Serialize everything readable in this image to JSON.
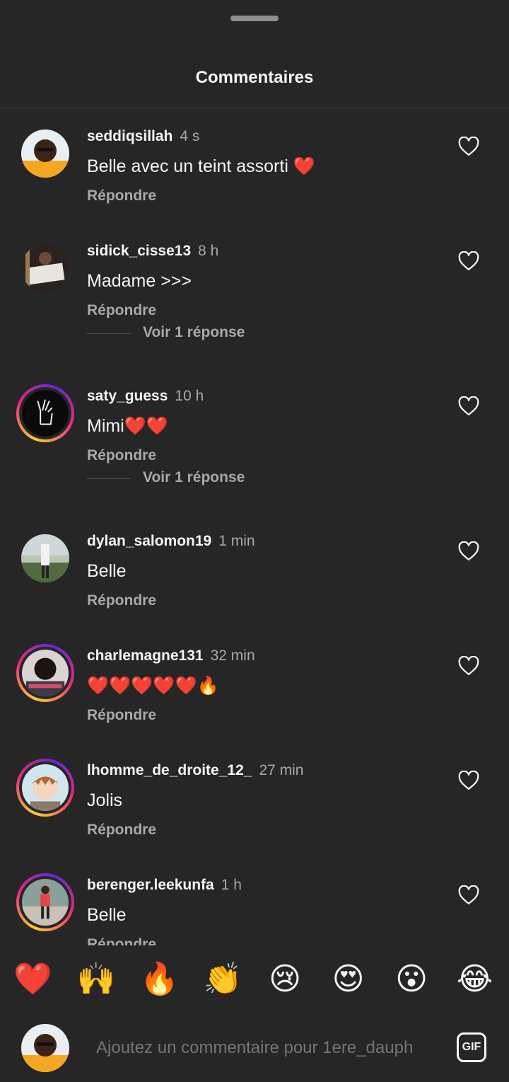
{
  "header": {
    "title": "Commentaires"
  },
  "comments": [
    {
      "username": "seddiqsillah",
      "time": "4 s",
      "text": "Belle avec un teint assorti ❤️",
      "reply_label": "Répondre",
      "ring": false,
      "avatar": "person-yellow-shirt"
    },
    {
      "username": "sidick_cisse13",
      "time": "8 h",
      "text": "Madame >>>",
      "reply_label": "Répondre",
      "ring": false,
      "avatar": "person-holding-sign",
      "view_replies": "Voir 1 réponse"
    },
    {
      "username": "saty_guess",
      "time": "10 h",
      "text": "Mimi❤️❤️",
      "reply_label": "Répondre",
      "ring": true,
      "avatar": "hand-sketch-black",
      "view_replies": "Voir 1 réponse"
    },
    {
      "username": "dylan_salomon19",
      "time": "1 min",
      "text": "Belle",
      "reply_label": "Répondre",
      "ring": false,
      "avatar": "person-outdoor-white"
    },
    {
      "username": "charlemagne131",
      "time": "32 min",
      "text": "❤️❤️❤️❤️❤️🔥",
      "reply_label": "Répondre",
      "ring": true,
      "avatar": "person-selfie"
    },
    {
      "username": "lhomme_de_droite_12_",
      "time": "27 min",
      "text": "Jolis",
      "reply_label": "Répondre",
      "ring": true,
      "avatar": "anime-character"
    },
    {
      "username": "berenger.leekunfa",
      "time": "1 h",
      "text": "Belle",
      "reply_label": "Répondre",
      "ring": true,
      "avatar": "person-red-shirt"
    }
  ],
  "emoji_bar": [
    {
      "char": "❤️",
      "name": "red-heart-emoji",
      "has_variants": false
    },
    {
      "char": "🙌",
      "name": "raising-hands-emoji",
      "has_variants": true
    },
    {
      "char": "🔥",
      "name": "fire-emoji",
      "has_variants": false
    },
    {
      "char": "👏",
      "name": "clapping-hands-emoji",
      "has_variants": true
    },
    {
      "char": "😢",
      "name": "crying-face-emoji",
      "has_variants": false
    },
    {
      "char": "😍",
      "name": "heart-eyes-emoji",
      "has_variants": false
    },
    {
      "char": "😮",
      "name": "surprised-face-emoji",
      "has_variants": false
    },
    {
      "char": "😂",
      "name": "tears-of-joy-emoji",
      "has_variants": false
    }
  ],
  "composer": {
    "placeholder": "Ajoutez un commentaire pour 1ere_dauph",
    "gif_label": "GIF"
  },
  "colors": {
    "background": "#262626",
    "primary_text": "#f5f5f5",
    "secondary_text": "#a8a8a8",
    "story_ring": [
      "#f9ce34",
      "#ee2a7b",
      "#6228d7"
    ]
  }
}
